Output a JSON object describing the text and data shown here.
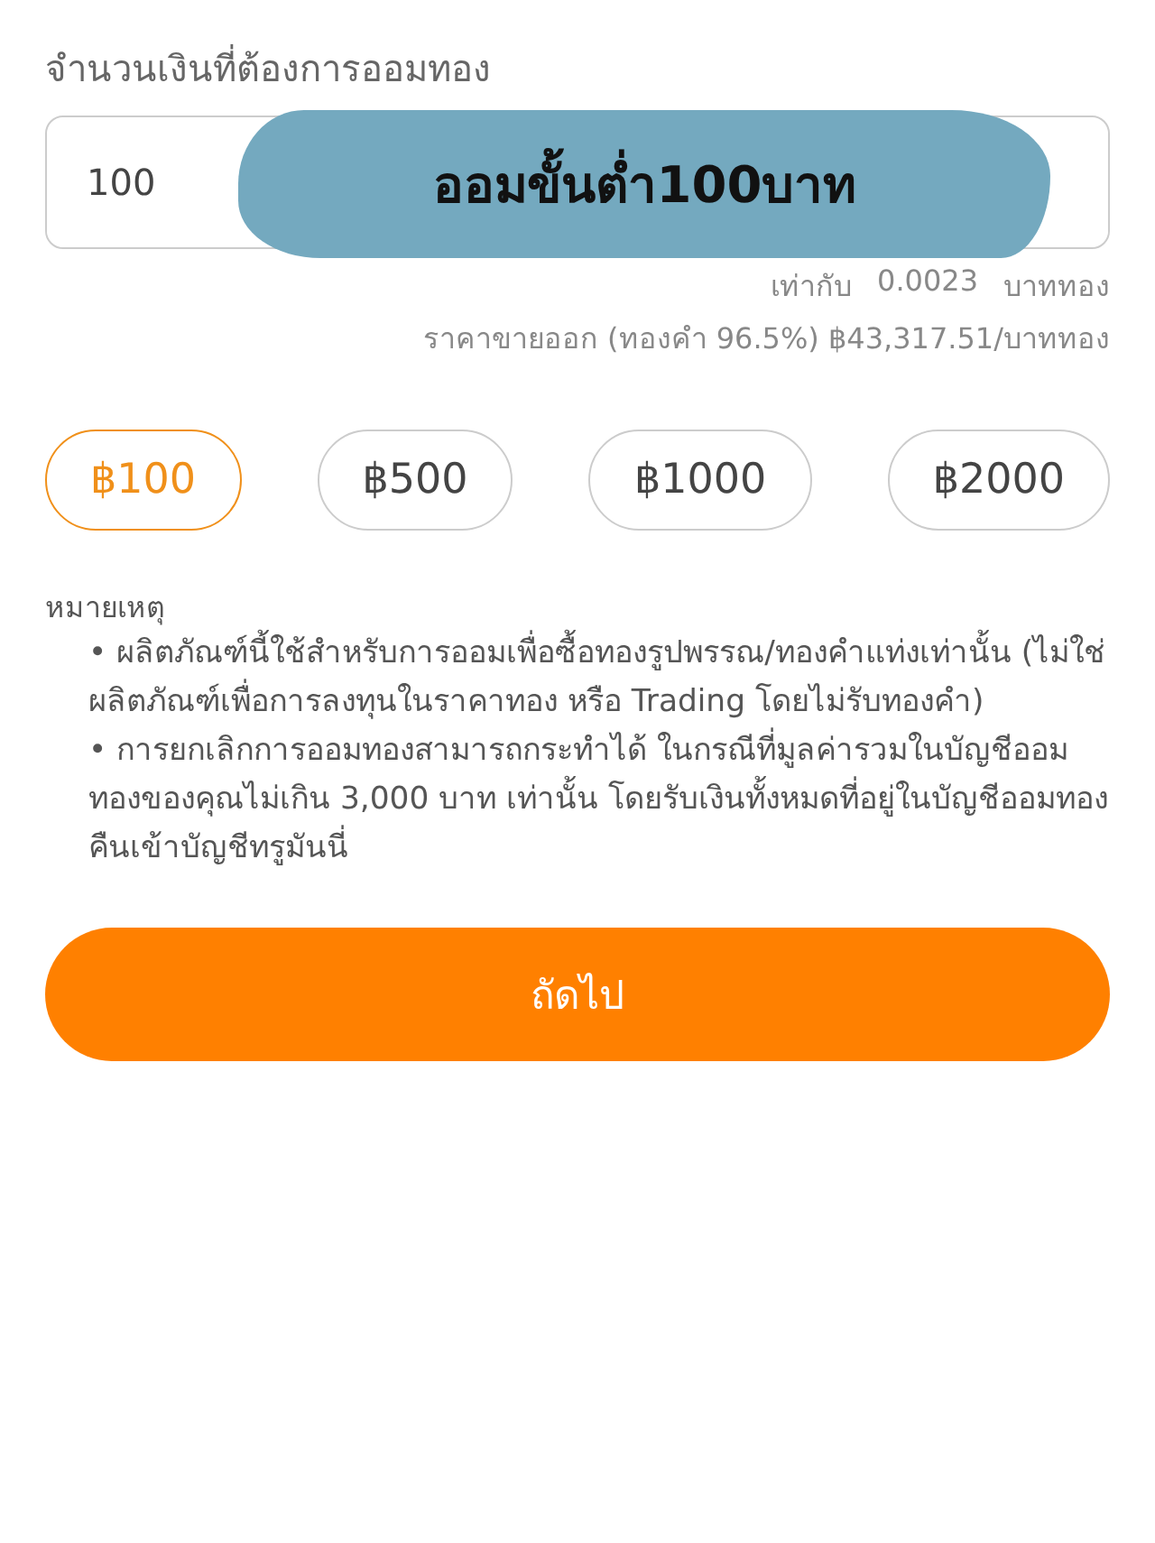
{
  "amount_field": {
    "label": "จำนวนเงินที่ต้องการออมทอง",
    "value": "100"
  },
  "annotation": {
    "text": "ออมขั้นต่ำ100บาท"
  },
  "equivalent": {
    "prefix": "เท่ากับ",
    "amount": "0.0023",
    "unit": "บาททอง"
  },
  "sell_price": "ราคาขายออก (ทองคำ 96.5%) ฿43,317.51/บาททอง",
  "quick_amounts": [
    {
      "label": "฿100",
      "selected": true
    },
    {
      "label": "฿500",
      "selected": false
    },
    {
      "label": "฿1000",
      "selected": false
    },
    {
      "label": "฿2000",
      "selected": false
    }
  ],
  "notes": {
    "title": "หมายเหตุ",
    "items": [
      "• ผลิตภัณฑ์นี้ใช้สำหรับการออมเพื่อซื้อทองรูปพรรณ/ทองคำแท่งเท่านั้น (ไม่ใช่ผลิตภัณฑ์เพื่อการลงทุนในราคาทอง หรือ Trading โดยไม่รับทองคำ)",
      "• การยกเลิกการออมทองสามารถกระทำได้ ในกรณีที่มูลค่ารวมในบัญชีออมทองของคุณไม่เกิน 3,000 บาท เท่านั้น โดยรับเงินทั้งหมดที่อยู่ในบัญชีออมทองคืนเข้าบัญชีทรูมันนี่"
    ]
  },
  "next_button": "ถัดไป"
}
